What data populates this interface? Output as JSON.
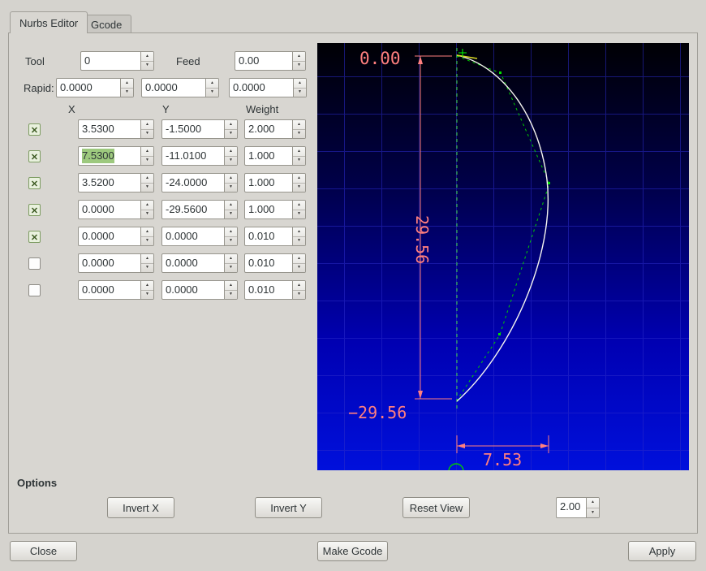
{
  "tabs": {
    "nurbs": "Nurbs Editor",
    "gcode": "Gcode"
  },
  "header": {
    "tool_label": "Tool",
    "tool_value": "0",
    "feed_label": "Feed",
    "feed_value": "0.00",
    "rapid_label": "Rapid:",
    "rapid1": "0.0000",
    "rapid2": "0.0000",
    "rapid3": "0.0000"
  },
  "columns": {
    "x": "X",
    "y": "Y",
    "weight": "Weight"
  },
  "rows": [
    {
      "checked": true,
      "x": "3.5300",
      "y": "-1.5000",
      "weight": "2.000"
    },
    {
      "checked": true,
      "x": "7.5300",
      "y": "-11.0100",
      "weight": "1.000",
      "x_selected": true
    },
    {
      "checked": true,
      "x": "3.5200",
      "y": "-24.0000",
      "weight": "1.000"
    },
    {
      "checked": true,
      "x": "0.0000",
      "y": "-29.5600",
      "weight": "1.000"
    },
    {
      "checked": true,
      "x": "0.0000",
      "y": "0.0000",
      "weight": "0.010"
    },
    {
      "checked": false,
      "x": "0.0000",
      "y": "0.0000",
      "weight": "0.010"
    },
    {
      "checked": false,
      "x": "0.0000",
      "y": "0.0000",
      "weight": "0.010"
    }
  ],
  "plot": {
    "dim_top": "0.00",
    "dim_height": "29.56",
    "dim_bottom": "−29.56",
    "dim_width": "7.53",
    "colors": {
      "dimension": "#ff7f7f",
      "curve": "#ffffff",
      "control": "#00cc00",
      "background_bottom": "#0010dc"
    }
  },
  "options": {
    "title": "Options",
    "invert_x": "Invert X",
    "invert_y": "Invert Y",
    "reset_view": "Reset View",
    "scale_value": "2.00"
  },
  "footer": {
    "close": "Close",
    "make_gcode": "Make Gcode",
    "apply": "Apply"
  }
}
